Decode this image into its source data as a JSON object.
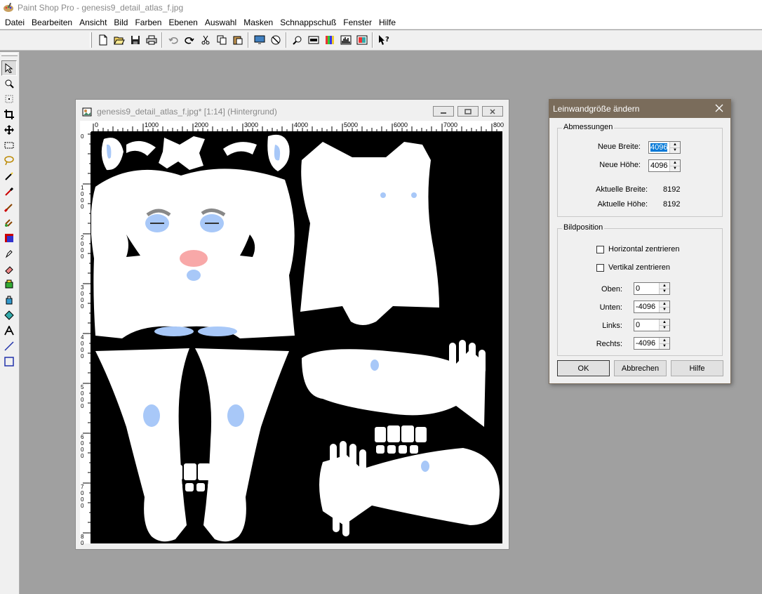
{
  "app": {
    "title": "Paint Shop Pro - genesis9_detail_atlas_f.jpg"
  },
  "menu": [
    "Datei",
    "Bearbeiten",
    "Ansicht",
    "Bild",
    "Farben",
    "Ebenen",
    "Auswahl",
    "Masken",
    "Schnappschuß",
    "Fenster",
    "Hilfe"
  ],
  "toolbar": {
    "buttons": [
      "new-icon",
      "open-icon",
      "save-icon",
      "print-icon",
      "undo-icon",
      "redo-icon",
      "cut-icon",
      "copy-icon",
      "paste-icon",
      "full-screen-icon",
      "browse-icon",
      "zoom-icon",
      "overview-icon",
      "color-palette-icon",
      "histogram-icon",
      "layers-icon",
      "help-context-icon"
    ]
  },
  "tools": [
    "arrow-tool-icon",
    "zoom-tool-icon",
    "deform-tool-icon",
    "crop-tool-icon",
    "mover-tool-icon",
    "selection-tool-icon",
    "freehand-tool-icon",
    "magic-wand-tool-icon",
    "dropper-tool-icon",
    "paint-brush-tool-icon",
    "clone-brush-tool-icon",
    "color-replacer-tool-icon",
    "retouch-tool-icon",
    "eraser-tool-icon",
    "picture-tube-tool-icon",
    "airbrush-tool-icon",
    "flood-fill-tool-icon",
    "text-tool-icon",
    "line-tool-icon",
    "shapes-tool-icon"
  ],
  "image_window": {
    "title": "genesis9_detail_atlas_f.jpg* [1:14] (Hintergrund)",
    "ruler_top": [
      "0",
      "1000",
      "2000",
      "3000",
      "4000",
      "5000",
      "6000",
      "7000",
      "800"
    ],
    "ruler_left": [
      "0",
      "1 0 0 0",
      "2 0 0 0",
      "3 0 0 0",
      "4 0 0 0",
      "5 0 0 0",
      "6 0 0 0",
      "7 0 0 0",
      "8 0"
    ]
  },
  "dialog": {
    "title": "Leinwandgröße ändern",
    "group_dimensions": "Abmessungen",
    "new_width_label": "Neue Breite:",
    "new_width_value": "4096",
    "new_height_label": "Neue Höhe:",
    "new_height_value": "4096",
    "current_width_label": "Aktuelle Breite:",
    "current_width_value": "8192",
    "current_height_label": "Aktuelle Höhe:",
    "current_height_value": "8192",
    "group_position": "Bildposition",
    "center_horizontal_label": "Horizontal zentrieren",
    "center_vertical_label": "Vertikal zentrieren",
    "top_label": "Oben:",
    "top_value": "0",
    "bottom_label": "Unten:",
    "bottom_value": "-4096",
    "left_label": "Links:",
    "left_value": "0",
    "right_label": "Rechts:",
    "right_value": "-4096",
    "ok": "OK",
    "cancel": "Abbrechen",
    "help": "Hilfe"
  },
  "colors": {
    "skin_white": "#ffffff",
    "detail_blue": "#a8c8f8",
    "lip_pink": "#f8a8a8",
    "dialog_titlebar": "#7a6c5b"
  }
}
